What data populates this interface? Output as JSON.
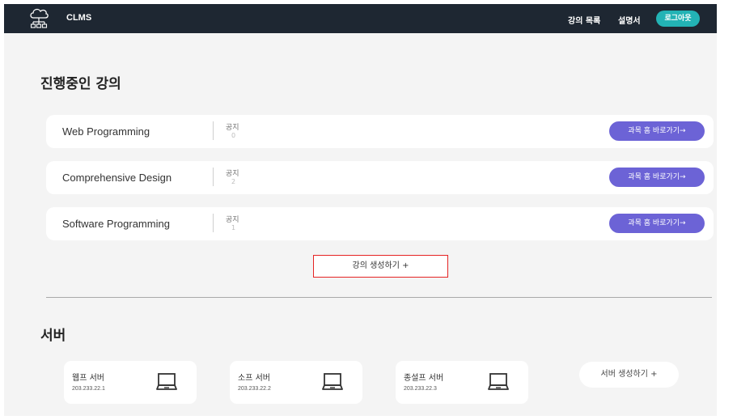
{
  "header": {
    "app_title": "CLMS",
    "logo_icon": "cloud-network-icon",
    "nav": {
      "courses": "강의 목록",
      "manual": "설명서",
      "logout": "로그아웃"
    },
    "colors": {
      "bar": "#1e2732",
      "logout": "#23b3b5"
    }
  },
  "courses": {
    "title": "진행중인 강의",
    "items": [
      {
        "name": "Web Programming",
        "notice_label": "공지",
        "notice_count": "0",
        "button": "과목 홈 바로가기→"
      },
      {
        "name": "Comprehensive Design",
        "notice_label": "공지",
        "notice_count": "2",
        "button": "과목 홈 바로가기→"
      },
      {
        "name": "Software Programming",
        "notice_label": "공지",
        "notice_count": "1",
        "button": "과목 홈 바로가기→"
      }
    ],
    "create_button": "강의 생성하기 +",
    "colors": {
      "button": "#6c63d6",
      "highlight": "#e52424"
    }
  },
  "servers": {
    "title": "서버",
    "items": [
      {
        "name": "웹프 서버",
        "ip": "203.233.22.1",
        "icon": "laptop-icon"
      },
      {
        "name": "소프 서버",
        "ip": "203.233.22.2",
        "icon": "laptop-icon"
      },
      {
        "name": "종설프 서버",
        "ip": "203.233.22.3",
        "icon": "laptop-icon"
      }
    ],
    "create_button": "서버 생성하기 +"
  }
}
